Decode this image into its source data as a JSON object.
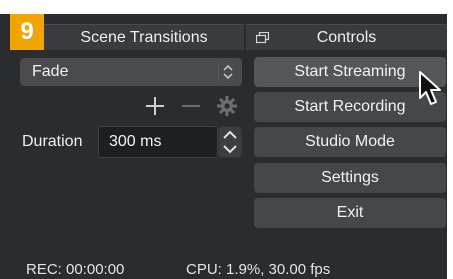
{
  "badge": "9",
  "scene_transitions": {
    "title": "Scene Transitions",
    "transition_value": "Fade",
    "duration_label": "Duration",
    "duration_value": "300 ms",
    "tool_icons": [
      "plus-icon",
      "minus-icon",
      "gear-icon"
    ]
  },
  "controls": {
    "title": "Controls",
    "buttons": [
      {
        "label": "Start Streaming"
      },
      {
        "label": "Start Recording"
      },
      {
        "label": "Studio Mode"
      },
      {
        "label": "Settings"
      },
      {
        "label": "Exit"
      }
    ]
  },
  "status_bar": {
    "rec": "REC: 00:00:00",
    "cpu": "CPU: 1.9%, 30.00 fps"
  },
  "colors": {
    "badge": "#f0a500",
    "panel": "#2b2c2e",
    "button": "#46474a"
  }
}
